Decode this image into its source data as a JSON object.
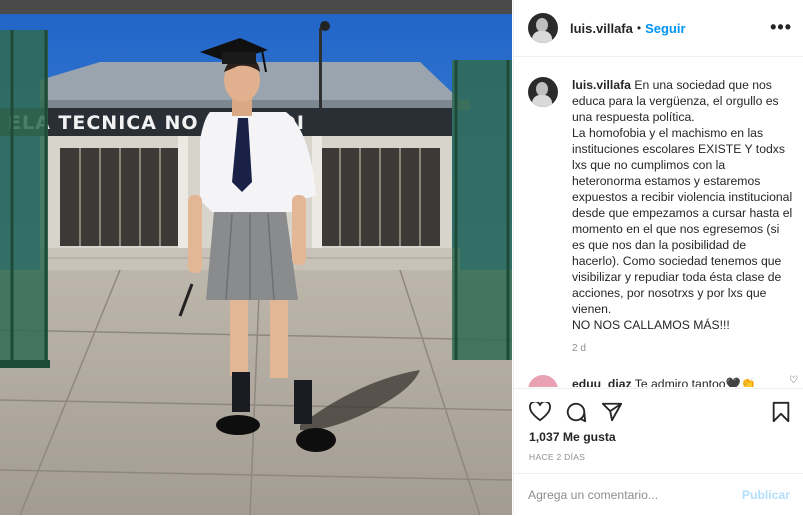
{
  "post": {
    "image_alt": "Estudiante con birrete, camisa blanca, corbata y falda gris frente a una escuela técnica",
    "building_sign": "ELA TECNICA NO   ALBERDI"
  },
  "header": {
    "username": "luis.villafa",
    "separator": "•",
    "follow_label": "Seguir",
    "more_label": "•••"
  },
  "caption": {
    "username": "luis.villafa",
    "text": " En una sociedad que nos educa para la vergüenza, el orgullo es una respuesta política.\nLa homofobia y el machismo en las instituciones escolares EXISTE Y todxs lxs que no cumplimos con la heteronorma estamos y estaremos expuestos a recibir violencia institucional desde que empezamos a cursar hasta el momento en el que nos egresemos (si es que nos dan la posibilidad de hacerlo). Como sociedad tenemos que visibilizar y repudiar toda ésta clase de acciones, por nosotrxs y por lxs que vienen.\nNO NOS CALLAMOS MÁS!!!",
    "time": "2 d"
  },
  "comment": {
    "username": "eduu_diaz",
    "text": " Te admiro tantoo🖤👏"
  },
  "actions": {
    "icons": [
      "heart-icon",
      "comment-icon",
      "share-icon",
      "bookmark-icon"
    ],
    "likes": "1,037 Me gusta",
    "time_ago": "HACE 2 DÍAS"
  },
  "add_comment": {
    "placeholder": "Agrega un comentario...",
    "publish_label": "Publicar"
  },
  "colors": {
    "accent": "#0095f6",
    "publish_disabled": "#b2dffc",
    "text": "#262626",
    "muted": "#8e8e8e"
  }
}
